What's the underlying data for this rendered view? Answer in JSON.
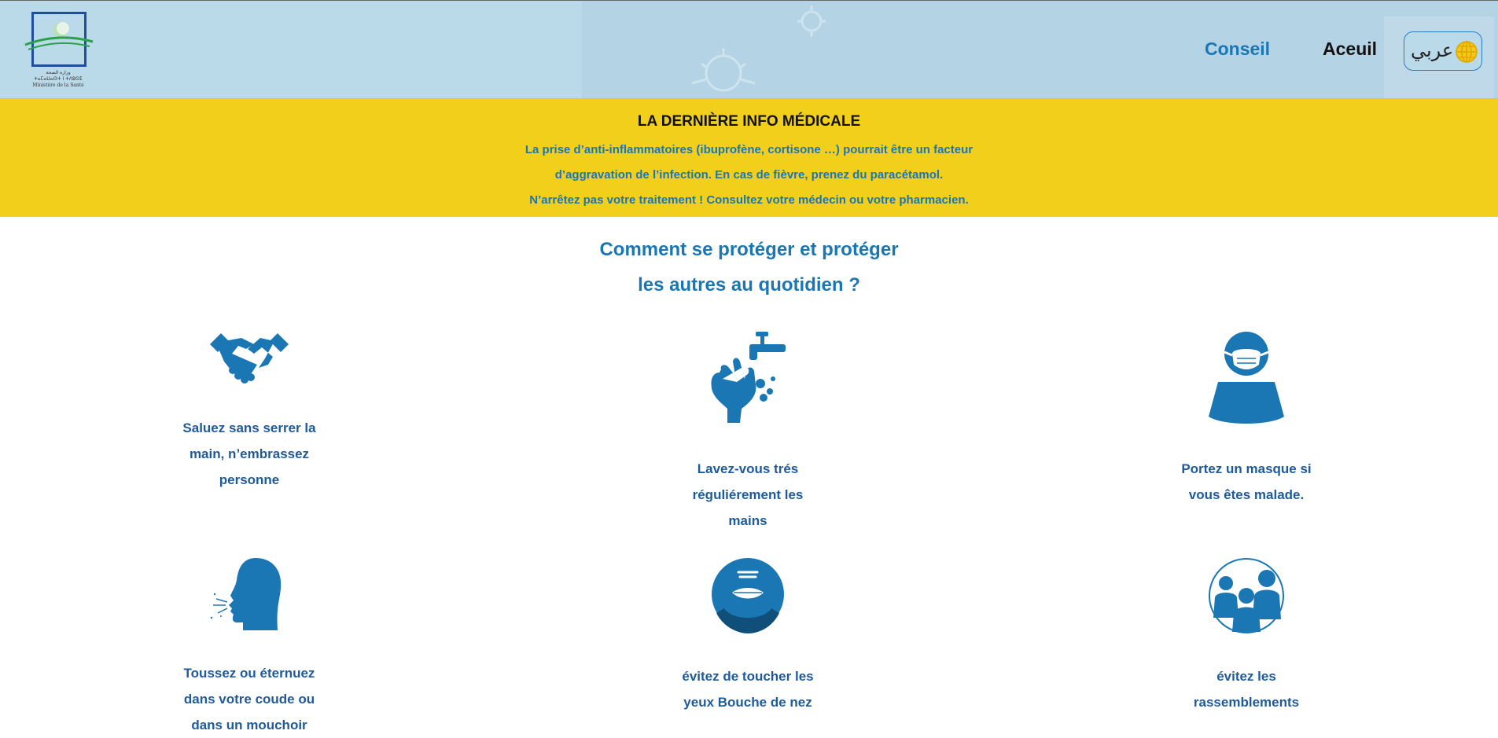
{
  "header": {
    "logo_text_ar": "وزارة الصحة",
    "logo_text_tz": "ⵜⴰⵎⴰⵡⴰⵙⵜ ⵏ ⵜⴷⵓⵙⵉ",
    "logo_text_fr": "Ministère de la Santé",
    "nav": [
      {
        "label": "Conseil"
      },
      {
        "label": "Aceuil"
      }
    ],
    "language_button": {
      "label": "عربي",
      "icon": "globe-icon"
    }
  },
  "banner": {
    "title": "LA DERNIÈRE INFO MÉDICALE",
    "lines": [
      "La prise d’anti-inflammatoires (ibuprofène, cortisone …) pourrait être un facteur",
      "d’aggravation de l’infection. En cas de fièvre, prenez du paracétamol.",
      "N’arrêtez pas votre traitement ! Consultez votre médecin ou votre pharmacien."
    ]
  },
  "section": {
    "title_line_1": "Comment se protéger et protéger",
    "title_line_2": "les autres au quotidien ?"
  },
  "tips": [
    {
      "icon": "handshake-icon",
      "lines": [
        "Saluez sans serrer la",
        "main, n’embrassez",
        "personne"
      ]
    },
    {
      "icon": "hand-washing-icon",
      "lines": [
        "Lavez-vous trés",
        "réguliérement les",
        "mains"
      ]
    },
    {
      "icon": "face-mask-icon",
      "lines": [
        "Portez un masque si",
        "vous êtes malade."
      ]
    },
    {
      "icon": "coughing-person-icon",
      "lines": [
        "Toussez ou éternuez",
        "dans votre coude ou",
        "dans un mouchoir"
      ]
    },
    {
      "icon": "face-icon",
      "lines": [
        "évitez de toucher les",
        "yeux Bouche de nez"
      ]
    },
    {
      "icon": "group-icon",
      "lines": [
        "évitez les",
        "rassemblements"
      ]
    }
  ],
  "colors": {
    "header_bg": "#bad9e9",
    "banner_bg": "#f2cf1b",
    "accent": "#1a77b4",
    "tip_text": "#1f5a9a"
  }
}
